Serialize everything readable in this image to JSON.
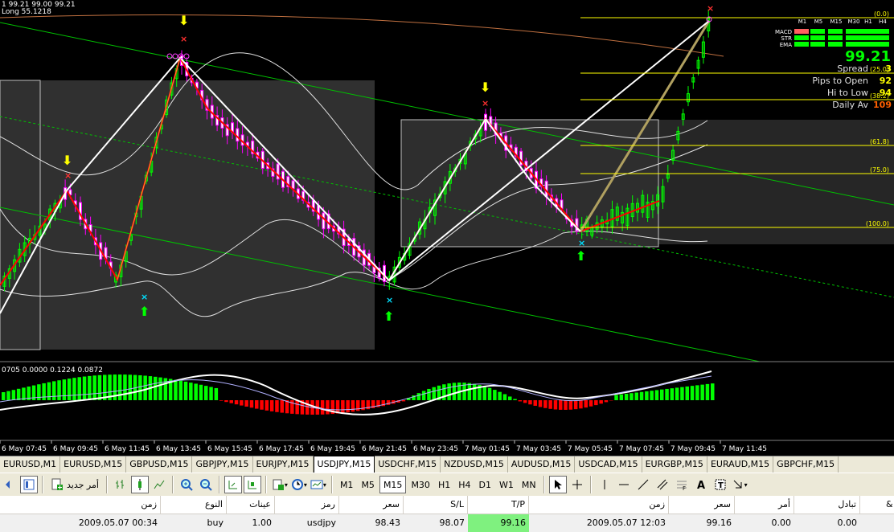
{
  "chart": {
    "top_info_line1": "1 99.21 99.00 99.21",
    "top_info_line2": "Long 55.1218",
    "indicator_label": "0705 0.0000 0.1224 0.0872",
    "price_big": "99.21",
    "info_rows": [
      {
        "label": "Spread",
        "value": "3"
      },
      {
        "label": "Pips to Open",
        "value": "92"
      },
      {
        "label": "Hi to Low",
        "value": "94"
      },
      {
        "label": "Daily Av",
        "value": "109"
      }
    ],
    "timeframes": [
      "M1",
      "M5",
      "M15",
      "M30",
      "H1",
      "H4"
    ],
    "panel_rows": [
      "MACD",
      "STR",
      "EMA"
    ],
    "fib_levels": [
      "(0.0)",
      "(25.0)",
      "(38.2)",
      "(61.8)",
      "(75.0)",
      "(100.0)"
    ],
    "time_labels": [
      "6 May 07:45",
      "6 May 09:45",
      "6 May 11:45",
      "6 May 13:45",
      "6 May 15:45",
      "6 May 17:45",
      "6 May 19:45",
      "6 May 21:45",
      "6 May 23:45",
      "7 May 01:45",
      "7 May 03:45",
      "7 May 05:45",
      "7 May 07:45",
      "7 May 09:45",
      "7 May 11:45"
    ],
    "colors": {
      "bull": "#00ff00",
      "bear": "#ff00ff",
      "zigzag": "#ff0000",
      "channel": "#00c000",
      "fib": "#ffff00",
      "hist_pos": "#00ff00",
      "hist_neg": "#ff0000"
    }
  },
  "tabs": [
    "EURUSD,M1",
    "EURUSD,M15",
    "GBPUSD,M15",
    "GBPJPY,M15",
    "EURJPY,M15",
    "USDJPY,M15",
    "USDCHF,M15",
    "NZDUSD,M15",
    "AUDUSD,M15",
    "USDCAD,M15",
    "EURGBP,M15",
    "EURAUD,M15",
    "GBPCHF,M15"
  ],
  "active_tab": "USDJPY,M15",
  "toolbar": {
    "new_order_label": "أمر جديد",
    "periods": [
      "M1",
      "M5",
      "M15",
      "M30",
      "H1",
      "H4",
      "D1",
      "W1",
      "MN"
    ],
    "active_period": "M15"
  },
  "table": {
    "headers": {
      "time": "زمن",
      "type": "النوع",
      "size": "عينات",
      "symbol": "رمز",
      "price": "سعر",
      "sl": "S/L",
      "tp": "T/P",
      "close_time": "زمن",
      "close_price": "سعر",
      "commission": "أمر",
      "swap": "تبادل"
    },
    "row": {
      "time": "2009.05.07 00:34",
      "type": "buy",
      "size": "1.00",
      "symbol": "usdjpy",
      "price": "98.43",
      "sl": "98.07",
      "tp": "99.16",
      "close_time": "2009.05.07 12:03",
      "close_price": "99.16",
      "commission": "0.00",
      "swap": "0.00"
    }
  }
}
